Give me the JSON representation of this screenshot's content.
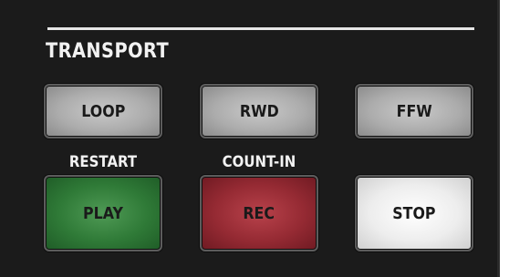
{
  "section": {
    "title": "TRANSPORT"
  },
  "buttons": {
    "loop": "LOOP",
    "rwd": "RWD",
    "ffw": "FFW",
    "play": "PLAY",
    "rec": "REC",
    "stop": "STOP"
  },
  "shift_labels": {
    "restart": "RESTART",
    "count_in": "COUNT-IN"
  },
  "colors": {
    "panel": "#1b1b1b",
    "play": "#2f7a37",
    "rec": "#952a33",
    "stop": "#ededed",
    "gray_button": "#acacac"
  }
}
